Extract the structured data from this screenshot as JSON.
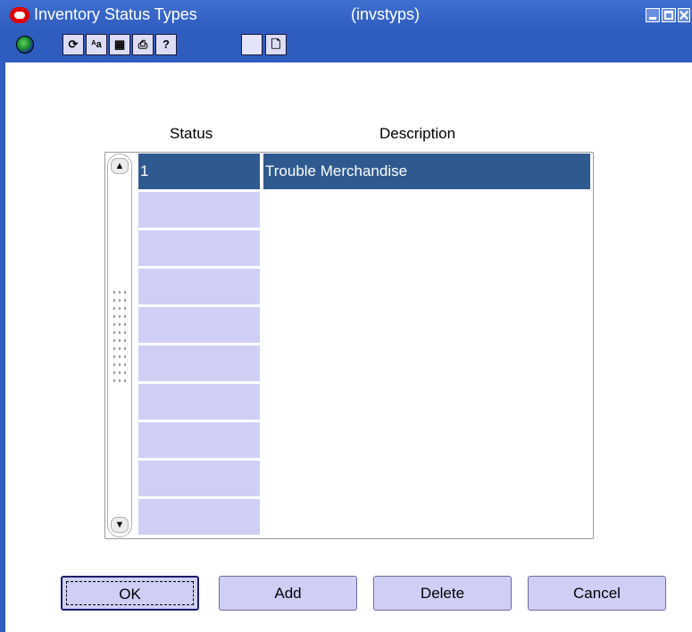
{
  "window": {
    "title": "Inventory Status Types",
    "form_code": "(invstyps)"
  },
  "toolbar": {
    "icons": [
      "globe-icon",
      "refresh-icon",
      "spellcheck-icon",
      "calendar-icon",
      "print-icon",
      "help-icon",
      "blank-icon",
      "new-doc-icon"
    ],
    "glyphs": {
      "refresh": "⟳",
      "spellcheck": "ᴬa",
      "calendar": "▦",
      "print": "⎙",
      "help": "?",
      "new_doc": "🗋"
    }
  },
  "grid": {
    "headers": {
      "status": "Status",
      "description": "Description"
    },
    "rows": [
      {
        "status": "1",
        "description": "Trouble Merchandise",
        "selected": true
      },
      {
        "status": "",
        "description": ""
      },
      {
        "status": "",
        "description": ""
      },
      {
        "status": "",
        "description": ""
      },
      {
        "status": "",
        "description": ""
      },
      {
        "status": "",
        "description": ""
      },
      {
        "status": "",
        "description": ""
      },
      {
        "status": "",
        "description": ""
      },
      {
        "status": "",
        "description": ""
      },
      {
        "status": "",
        "description": ""
      }
    ],
    "scroll_up": "▲",
    "scroll_down": "▼"
  },
  "buttons": {
    "ok": "OK",
    "add": "Add",
    "delete": "Delete",
    "cancel": "Cancel"
  },
  "colors": {
    "title_bar": "#2f5cbf",
    "selected_row": "#2f5a8f",
    "cell_fill": "#cfcff6"
  }
}
